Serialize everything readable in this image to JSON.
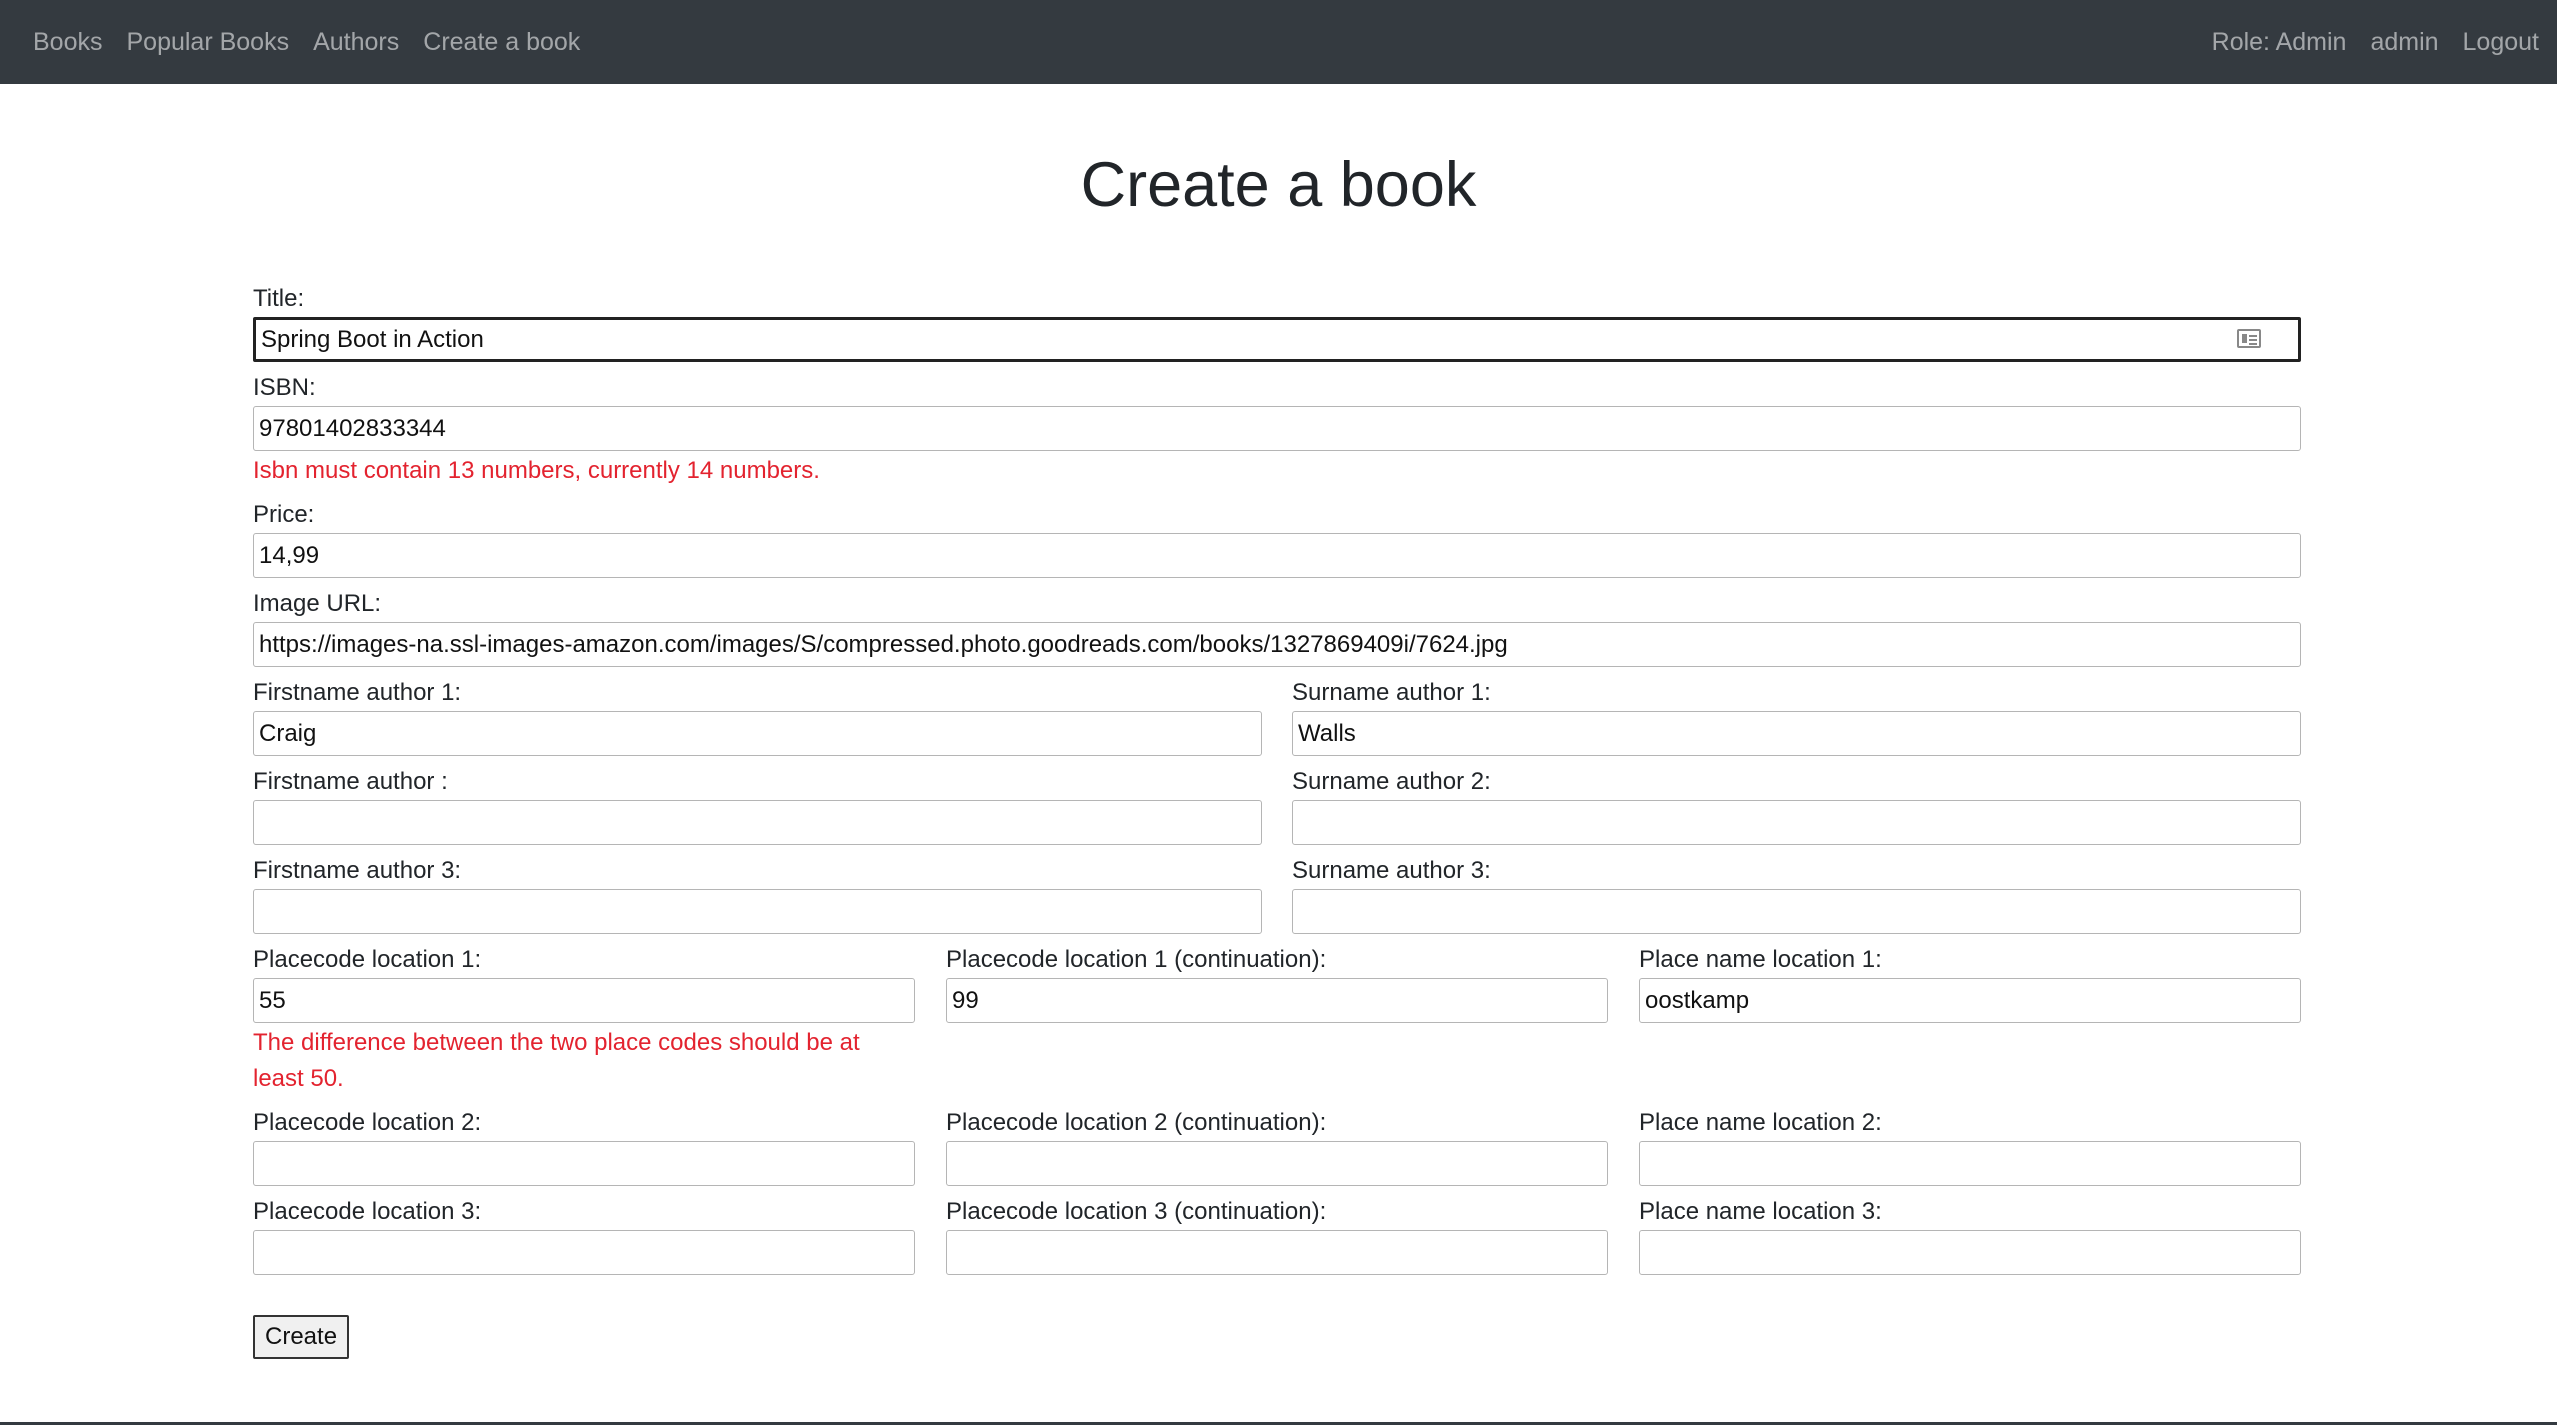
{
  "nav": {
    "left": [
      "Books",
      "Popular Books",
      "Authors",
      "Create a book"
    ],
    "role": "Role: Admin",
    "user": "admin",
    "logout": "Logout"
  },
  "page_title": "Create a book",
  "form": {
    "title": {
      "label": "Title:",
      "value": "Spring Boot in Action"
    },
    "isbn": {
      "label": "ISBN:",
      "value": "97801402833344",
      "error": "Isbn must contain 13 numbers, currently 14 numbers."
    },
    "price": {
      "label": "Price:",
      "value": "14,99"
    },
    "image_url": {
      "label": "Image URL:",
      "value": "https://images-na.ssl-images-amazon.com/images/S/compressed.photo.goodreads.com/books/1327869409i/7624.jpg"
    },
    "authors": [
      {
        "first_label": "Firstname author 1:",
        "first_value": "Craig",
        "sur_label": "Surname author 1:",
        "sur_value": "Walls"
      },
      {
        "first_label": "Firstname author :",
        "first_value": "",
        "sur_label": "Surname author 2:",
        "sur_value": ""
      },
      {
        "first_label": "Firstname author 3:",
        "first_value": "",
        "sur_label": "Surname author 3:",
        "sur_value": ""
      }
    ],
    "locations": [
      {
        "code_label": "Placecode location 1:",
        "code_value": "55",
        "cont_label": "Placecode location 1 (continuation):",
        "cont_value": "99",
        "name_label": "Place name location 1:",
        "name_value": "oostkamp",
        "error": "The difference between the two place codes should be at least 50."
      },
      {
        "code_label": "Placecode location 2:",
        "code_value": "",
        "cont_label": "Placecode location 2 (continuation):",
        "cont_value": "",
        "name_label": "Place name location 2:",
        "name_value": ""
      },
      {
        "code_label": "Placecode location 3:",
        "code_value": "",
        "cont_label": "Placecode location 3 (continuation):",
        "cont_value": "",
        "name_label": "Place name location 3:",
        "name_value": ""
      }
    ],
    "submit_label": "Create"
  },
  "colors": {
    "navbar": "#343a40",
    "error": "#e3232f"
  }
}
